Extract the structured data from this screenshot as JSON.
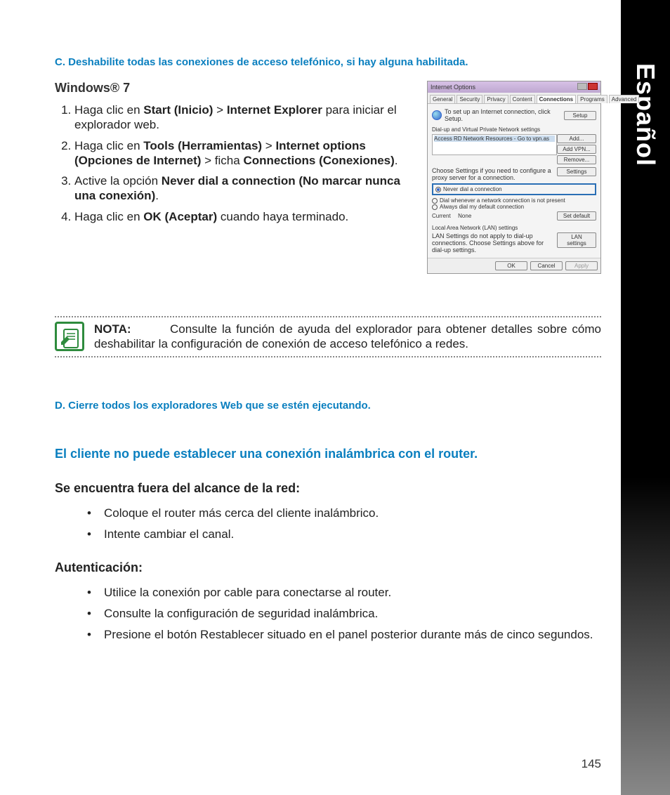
{
  "sidebar": {
    "label": "Español"
  },
  "pageNumber": "145",
  "sectionC": {
    "title": "C.   Deshabilite todas las conexiones de acceso telefónico, si hay alguna habilitada."
  },
  "osTitle": "Windows® 7",
  "steps": [
    {
      "pre": "Haga clic en ",
      "b1": "Start (Inicio)",
      "mid1": " > ",
      "b2": "Internet Explorer",
      "post": " para iniciar el explorador web."
    },
    {
      "pre": "Haga clic en ",
      "b1": "Tools (Herramientas)",
      "mid1": " > ",
      "b2": "Internet options (Opciones de Internet)",
      "mid2": " > ficha ",
      "b3": "Connections (Conexio­nes)",
      "post": "."
    },
    {
      "pre": "Active la opción ",
      "b1": "Never dial a connection (No marcar nunca una conexión)",
      "post": "."
    },
    {
      "pre": "Haga clic en ",
      "b1": "OK (Aceptar)",
      "post": " cuando haya terminado."
    }
  ],
  "dialog": {
    "title": "Internet Options",
    "tabs": [
      "General",
      "Security",
      "Privacy",
      "Content",
      "Connections",
      "Programs",
      "Advanced"
    ],
    "activeTab": "Connections",
    "setupText": "To set up an Internet connection, click Setup.",
    "btnSetup": "Setup",
    "grpDial": "Dial-up and Virtual Private Network settings",
    "listItem": "Access RD Network Resources - Go to vpn.as",
    "btnAdd": "Add...",
    "btnAddVpn": "Add VPN...",
    "btnRemove": "Remove...",
    "proxyText": "Choose Settings if you need to configure a proxy server for a connection.",
    "btnSettings": "Settings",
    "radioNever": "Never dial a connection",
    "radioWhen": "Dial whenever a network connection is not present",
    "radioAlways": "Always dial my default connection",
    "currentLabel": "Current",
    "currentValue": "None",
    "btnSetDefault": "Set default",
    "lanTitle": "Local Area Network (LAN) settings",
    "lanText": "LAN Settings do not apply to dial-up connections. Choose Settings above for dial-up settings.",
    "btnLan": "LAN settings",
    "btnOk": "OK",
    "btnCancel": "Cancel",
    "btnApply": "Apply"
  },
  "note": {
    "label": "NOTA:",
    "text": "Consulte la función de ayuda del explorador para obtener detalles sobre cómo deshabilitar la configuración de conexión de acceso telefónico a redes."
  },
  "sectionD": {
    "title": "D.   Cierre todos los exploradores Web que se estén ejecutando."
  },
  "issue": {
    "title": "El cliente no puede establecer una conexión inalámbrica con el router."
  },
  "range": {
    "title": "Se encuentra fuera del alcance de la red:",
    "items": [
      "Coloque el router más cerca del cliente inalámbrico.",
      "Intente cambiar el canal."
    ]
  },
  "auth": {
    "title": "Autenticación:",
    "items": [
      "Utilice la conexión por cable para conectarse al router.",
      "Consulte la configuración de seguridad inalámbrica.",
      "Presione el botón Restablecer situado en el panel posterior durante más de cinco segundos."
    ]
  }
}
